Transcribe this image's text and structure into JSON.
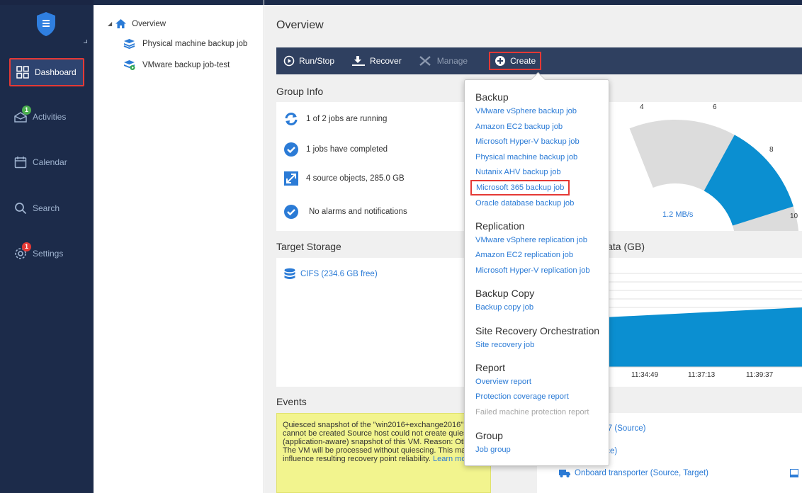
{
  "nav": {
    "items": [
      {
        "label": "Dashboard",
        "icon": "dashboard-icon"
      },
      {
        "label": "Activities",
        "icon": "activities-icon",
        "badge": "1"
      },
      {
        "label": "Calendar",
        "icon": "calendar-icon"
      },
      {
        "label": "Search",
        "icon": "search-icon"
      },
      {
        "label": "Settings",
        "icon": "settings-icon",
        "badge": "1"
      }
    ]
  },
  "tree": {
    "root": "Overview",
    "children": [
      "Physical machine backup job",
      "VMware backup job-test"
    ]
  },
  "main": {
    "title": "Overview",
    "toolbar": {
      "run_stop": "Run/Stop",
      "recover": "Recover",
      "manage": "Manage",
      "create": "Create"
    },
    "group_info": {
      "title": "Group Info",
      "rows": [
        "1 of 2 jobs are running",
        "1 jobs have completed",
        "4 source objects, 285.0 GB",
        "No alarms and notifications"
      ]
    },
    "gauge": {
      "ticks": [
        "4",
        "6",
        "8",
        "10"
      ],
      "speed": "1.2 MB/s",
      "level": 0.12
    },
    "target_storage": {
      "title": "Target Storage",
      "item": "CIFS (234.6 GB free)"
    },
    "data_panel": {
      "title_fragment": "Data (GB)",
      "times": [
        "11:34:49",
        "11:37:13",
        "11:39:37"
      ]
    },
    "events": {
      "title": "Events",
      "text": "Quiesced snapshot of the \"win2016+exchange2016\" VM cannot be created Source host could not create quiesced (application-aware) snapshot of this VM. Reason: Other. The VM will be processed without quiescing. This may influence resulting recovery point reliability.",
      "link": "Learn more"
    },
    "nodes": {
      "row1": "197 (Source)",
      "row2": "urce)",
      "row3": "Onboard transporter (Source, Target)"
    }
  },
  "create_menu": {
    "sections": [
      {
        "title": "Backup",
        "items": [
          {
            "label": "VMware vSphere backup job"
          },
          {
            "label": "Amazon EC2 backup job"
          },
          {
            "label": "Microsoft Hyper-V backup job"
          },
          {
            "label": "Physical machine backup job"
          },
          {
            "label": "Nutanix AHV backup job"
          },
          {
            "label": "Microsoft 365 backup job"
          },
          {
            "label": "Oracle database backup job"
          }
        ]
      },
      {
        "title": "Replication",
        "items": [
          {
            "label": "VMware vSphere replication job"
          },
          {
            "label": "Amazon EC2 replication job"
          },
          {
            "label": "Microsoft Hyper-V replication job"
          }
        ]
      },
      {
        "title": "Backup Copy",
        "items": [
          {
            "label": "Backup copy job"
          }
        ]
      },
      {
        "title": "Site Recovery Orchestration",
        "items": [
          {
            "label": "Site recovery job"
          }
        ]
      },
      {
        "title": "Report",
        "items": [
          {
            "label": "Overview report"
          },
          {
            "label": "Protection coverage report"
          },
          {
            "label": "Failed machine protection report"
          }
        ]
      },
      {
        "title": "Group",
        "items": [
          {
            "label": "Job group"
          }
        ]
      }
    ]
  },
  "colors": {
    "nav_bg": "#1c2b4a",
    "toolbar_bg": "#2f4060",
    "accent_blue": "#2b7bd6",
    "highlight_red": "#e53935",
    "chart_blue": "#0b8fd1"
  }
}
